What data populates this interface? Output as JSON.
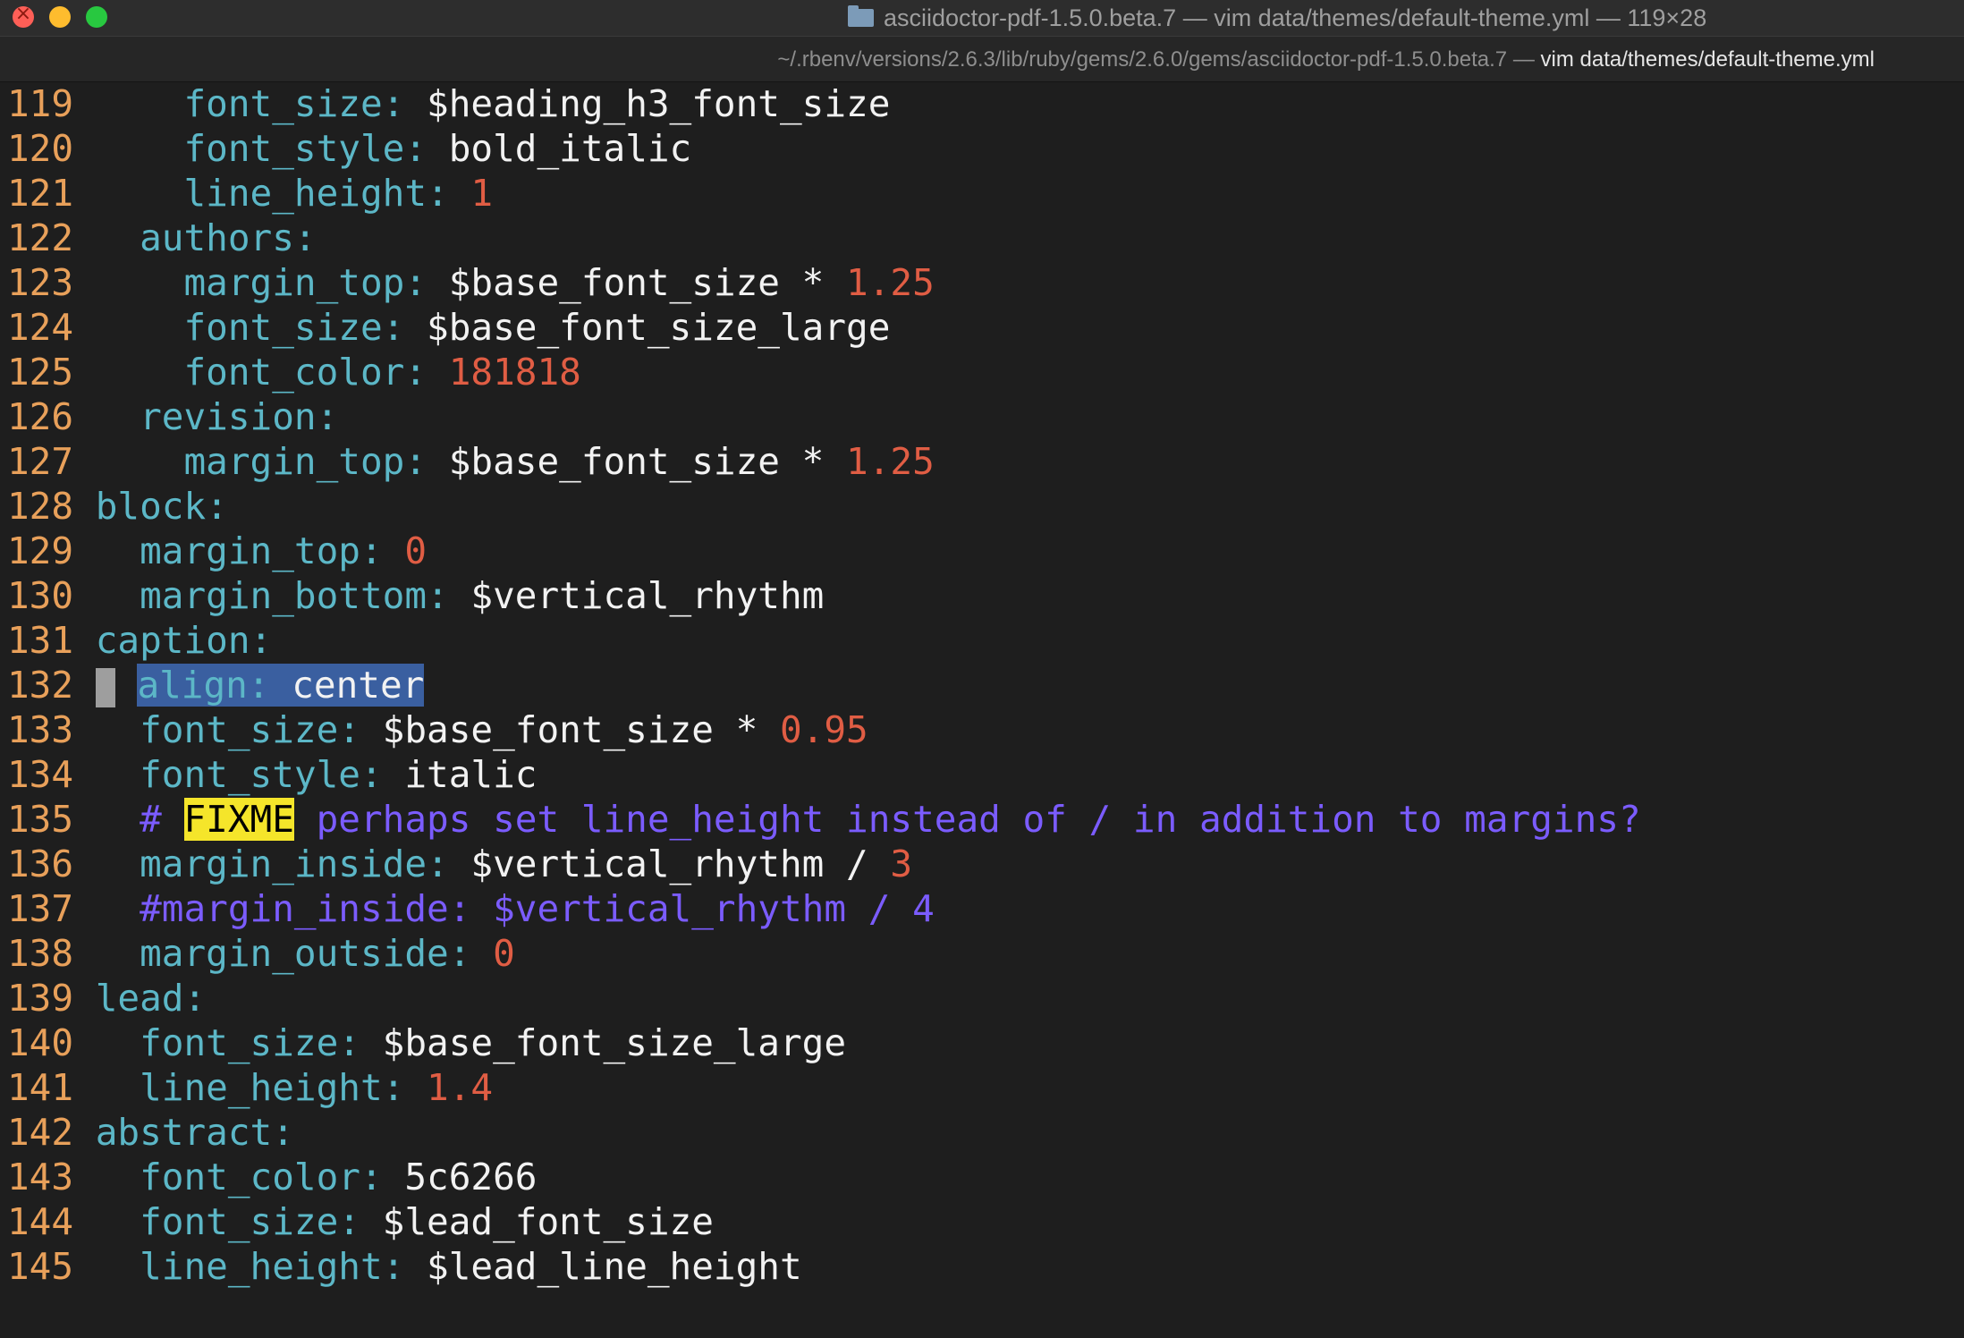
{
  "window": {
    "title": "asciidoctor-pdf-1.5.0.beta.7 — vim data/themes/default-theme.yml — 119×28",
    "tab_path": "~/.rbenv/versions/2.6.3/lib/ruby/gems/2.6.0/gems/asciidoctor-pdf-1.5.0.beta.7 — ",
    "tab_command": "vim data/themes/default-theme.yml"
  },
  "editor": {
    "lines": [
      {
        "num": "119",
        "indent": "    ",
        "key": "font_size",
        "value": "$heading_h3_font_size"
      },
      {
        "num": "120",
        "indent": "    ",
        "key": "font_style",
        "value": "bold_italic"
      },
      {
        "num": "121",
        "indent": "    ",
        "key": "line_height",
        "number": "1"
      },
      {
        "num": "122",
        "indent": "  ",
        "key": "authors"
      },
      {
        "num": "123",
        "indent": "    ",
        "key": "margin_top",
        "value": "$base_font_size * ",
        "number": "1.25"
      },
      {
        "num": "124",
        "indent": "    ",
        "key": "font_size",
        "value": "$base_font_size_large"
      },
      {
        "num": "125",
        "indent": "    ",
        "key": "font_color",
        "number": "181818"
      },
      {
        "num": "126",
        "indent": "  ",
        "key": "revision"
      },
      {
        "num": "127",
        "indent": "    ",
        "key": "margin_top",
        "value": "$base_font_size * ",
        "number": "1.25"
      },
      {
        "num": "128",
        "indent": "",
        "key": "block"
      },
      {
        "num": "129",
        "indent": "  ",
        "key": "margin_top",
        "number": "0"
      },
      {
        "num": "130",
        "indent": "  ",
        "key": "margin_bottom",
        "value": "$vertical_rhythm"
      },
      {
        "num": "131",
        "indent": "",
        "key": "caption"
      },
      {
        "num": "132",
        "indent": "  ",
        "key": "align",
        "value": "center"
      },
      {
        "num": "133",
        "indent": "  ",
        "key": "font_size",
        "value": "$base_font_size * ",
        "number": "0.95"
      },
      {
        "num": "134",
        "indent": "  ",
        "key": "font_style",
        "value": "italic"
      },
      {
        "num": "135",
        "indent": "  ",
        "comment_hash": "# ",
        "todo": "FIXME",
        "comment_rest": " perhaps set line_height instead of / in addition to margins?"
      },
      {
        "num": "136",
        "indent": "  ",
        "key": "margin_inside",
        "value": "$vertical_rhythm / ",
        "number": "3"
      },
      {
        "num": "137",
        "indent": "  ",
        "comment": "#margin_inside: $vertical_rhythm / 4"
      },
      {
        "num": "138",
        "indent": "  ",
        "key": "margin_outside",
        "number": "0"
      },
      {
        "num": "139",
        "indent": "",
        "key": "lead"
      },
      {
        "num": "140",
        "indent": "  ",
        "key": "font_size",
        "value": "$base_font_size_large"
      },
      {
        "num": "141",
        "indent": "  ",
        "key": "line_height",
        "number": "1.4"
      },
      {
        "num": "142",
        "indent": "",
        "key": "abstract"
      },
      {
        "num": "143",
        "indent": "  ",
        "key": "font_color",
        "value": "5c6266"
      },
      {
        "num": "144",
        "indent": "  ",
        "key": "font_size",
        "value": "$lead_font_size"
      },
      {
        "num": "145",
        "indent": "  ",
        "key": "line_height",
        "value": "$lead_line_height"
      }
    ]
  },
  "colors": {
    "background": "#1e1e1e",
    "line_number": "#e8a05a",
    "key": "#5cb7c7",
    "value": "#f2f2f2",
    "number": "#e05d44",
    "comment": "#7b5cff",
    "todo_highlight": "#f5e52a",
    "visual_selection": "#3a5fa0"
  }
}
